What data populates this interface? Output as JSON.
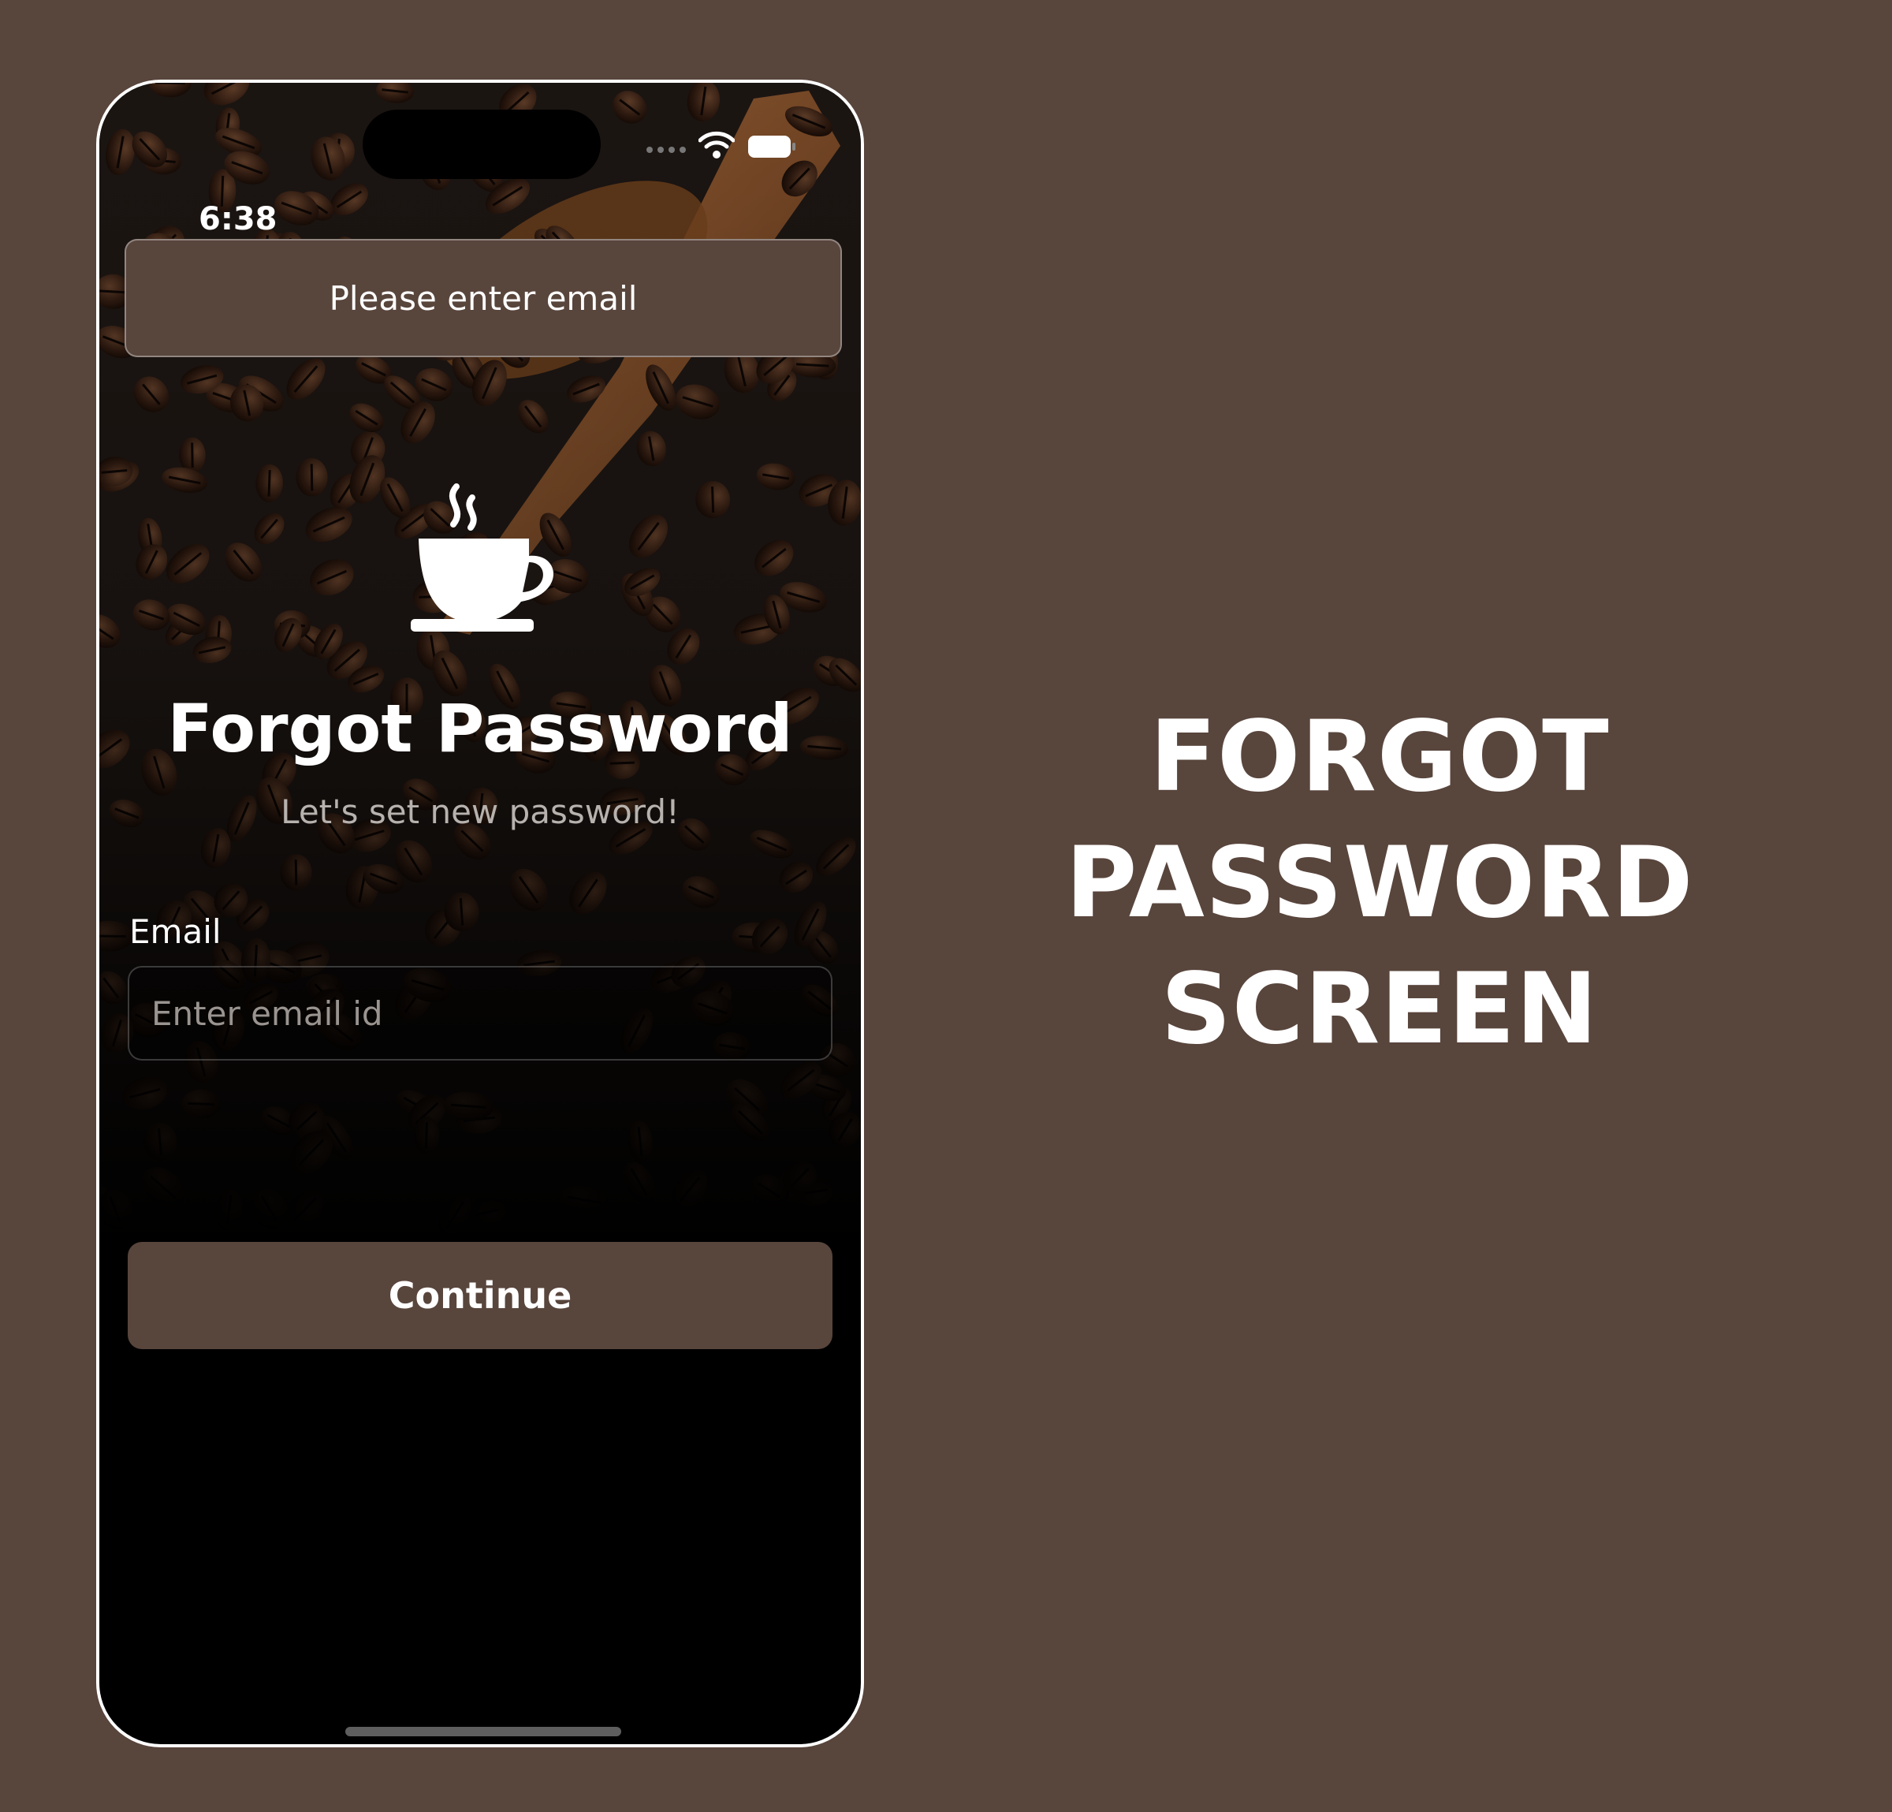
{
  "status_bar": {
    "time": "6:38"
  },
  "toast": {
    "message": "Please enter email"
  },
  "screen": {
    "title": "Forgot Password",
    "subtitle": "Let's set new password!",
    "email_label": "Email",
    "email_placeholder": "Enter email id",
    "email_value": "",
    "continue_label": "Continue"
  },
  "caption": {
    "line1": "FORGOT",
    "line2": "PASSWORD",
    "line3": "SCREEN"
  },
  "icons": [
    "wifi-icon",
    "battery-icon",
    "coffee-cup-icon"
  ],
  "colors": {
    "page_background": "#58453c",
    "button": "#58453c",
    "toast": "#58453c",
    "text": "#ffffff",
    "subtitle": "#b7b2ae"
  }
}
